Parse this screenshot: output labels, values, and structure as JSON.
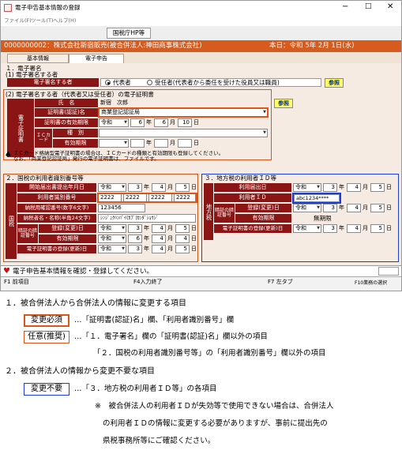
{
  "window": {
    "title": "電子申告基本情報の登録",
    "menus": [
      "ファイル(F)",
      "ツール(T)",
      "ヘルプ(H)"
    ],
    "toolbar_button": "国税庁HP等"
  },
  "header": {
    "company": "0000000002：株式会社新宿販売(被合併法人:神田商事株式会社)",
    "date": "本日：令和 5年 2月 1日(水)"
  },
  "tabs": [
    "基本情報",
    "電子申告"
  ],
  "s1": {
    "title": "１．電子署名",
    "sub1": "(1) 電子署名する者",
    "signer_label": "電子署名する者",
    "opt1": "代表者",
    "opt2": "受任者(代表者から委任を受けた役員又は職員)",
    "ref_btn": "参照",
    "sub2": "(2) 電子署名する者（代表者又は受任者）の電子証明書",
    "vlabel": "電子証明書",
    "name_label": "氏　名",
    "name_value": "新宿　次郎",
    "cert_label": "証明書(認証)名",
    "cert_value": "商業登記認証局",
    "valid_label": "証明書の有効期限",
    "era": "令和",
    "y": "6",
    "m": "6",
    "d": "10",
    "u_y": "年",
    "u_m": "月",
    "u_d": "日",
    "ic_label": "ＩＣカード",
    "kind_label": "種　別",
    "exp_label": "有効期限",
    "note1": "ＩＣカード格納型電子証明書の場合は、ＩＣカードの種類と有効期限も登録してください。",
    "note2": "なお、「商業登記認証局」発行の電子証明書は、ファイルです。"
  },
  "s2": {
    "title": "２．国税の利用者識別番号等",
    "vlabel": "国税",
    "l1": "開始届出書提出年月日",
    "v1": [
      "令和",
      "3",
      "4",
      "5"
    ],
    "l2": "利用者識別番号",
    "v2": [
      "2222",
      "2222",
      "2222",
      "2222"
    ],
    "l3": "納税用確認番号(数字6文字)",
    "v3": "123456",
    "l4": "納税者名・名称(半角24文字)",
    "v4": "ｼﾝｼﾞｭｸﾊﾝﾊﾞｲ(ｶﾌﾞ)ｶﾝﾀﾞｼｮｳｼﾞ",
    "grp": "暗証の暗証番号",
    "l5": "登録(変更)日",
    "v5": [
      "令和",
      "3",
      "4",
      "5"
    ],
    "l6": "有効期限",
    "v6": [
      "令和",
      "6",
      "4",
      "4"
    ],
    "l7": "電子証明書の登録(更新)日",
    "v7": [
      "令和",
      "3",
      "4",
      "5"
    ]
  },
  "s3": {
    "title": "３．地方税の利用者ＩＤ等",
    "vlabel": "地方税",
    "l1": "利用届出日",
    "v1": [
      "令和",
      "3",
      "4",
      "5"
    ],
    "l2": "利用者ＩＤ",
    "v2": "abc1234****",
    "grp": "暗証の暗証番号",
    "l3": "登録(変更)日",
    "v3": [
      "令和",
      "3",
      "4",
      "5"
    ],
    "l4": "有効期限",
    "v4": "無期限",
    "l5": "電子証明書の登録(更新)日",
    "v5": [
      "令和",
      "3",
      "4",
      "5"
    ]
  },
  "status_msg": "電子申告基本情報を確認・登録してください。",
  "fkeys": [
    "F1 前項目",
    "F4入力終了",
    "F7 左タブ",
    "F10業務の選択"
  ],
  "desc": {
    "h1": "１．被合併法人から合併法人の情報に変更する項目",
    "tag_req": "変更必須",
    "t1": "…「証明書(認証)名」欄、「利用者識別番号」欄",
    "tag_opt": "任意(推奨)",
    "t2": "…「１．電子署名」欄の「証明書(認証)名」欄以外の項目",
    "t3": "「２．国税の利用者識別番号等」の「利用者識別番号」欄以外の項目",
    "h2": "２．被合併法人の情報から変更不要な項目",
    "tag_no": "変更不要",
    "t4": "…「３．地方税の利用者ＩＤ等」の各項目",
    "n1": "※　被合併法人の利用者ＩＤが失効等で使用できない場合は、合併法人",
    "n2": "の利用者ＩＤの情報に変更する必要がありますが、事前に提出先の",
    "n3": "県税事務所等にご確認ください。"
  },
  "colors": {
    "header": "#d85b1e",
    "label": "#8b1414",
    "required": "#e0541a",
    "unneeded": "#1a3fd8"
  }
}
